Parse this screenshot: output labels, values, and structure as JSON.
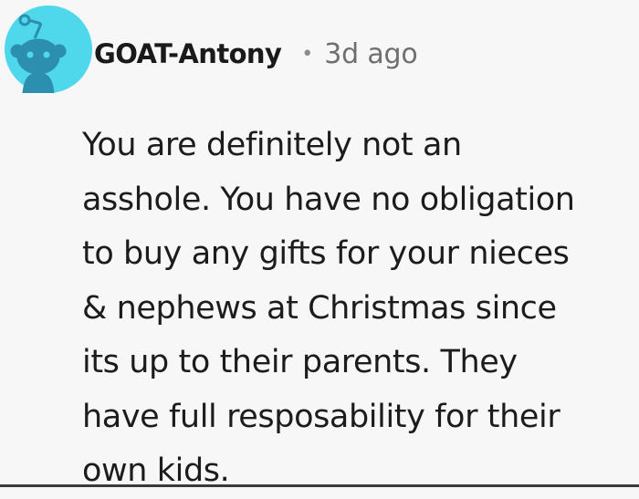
{
  "comment": {
    "username": "GOAT-Antony",
    "separator": "•",
    "timestamp": "3d ago",
    "avatar_icon": "reddit-snoo-avatar-icon",
    "colors": {
      "avatar_bg": "#4fd8eb",
      "snoo": "#2d8fb0",
      "page_bg": "#f7f7f7",
      "text": "#1c1c1c",
      "meta": "#6f6f6f"
    },
    "body_lines": [
      "You are definitely not an",
      "asshole. You have no obligation",
      "to buy any gifts for your nieces",
      "& nephews at Christmas since",
      "its up to their parents. They",
      "have full resposability for their",
      "own kids."
    ]
  }
}
